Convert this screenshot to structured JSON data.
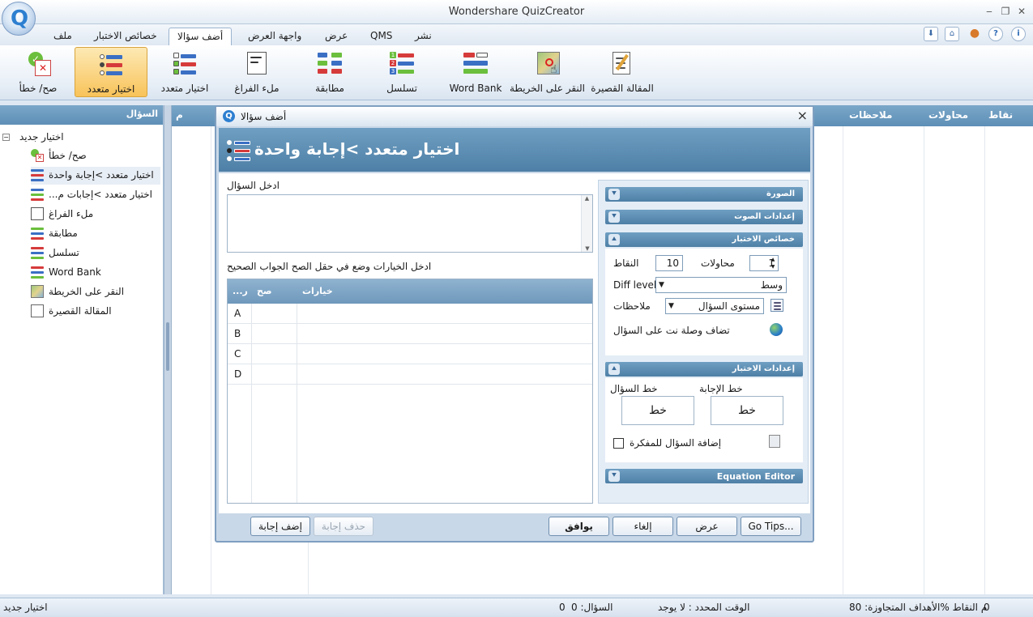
{
  "app": {
    "title": "Wondershare QuizCreator"
  },
  "tabs": {
    "file": "ملف",
    "properties": "خصائص الاختبار",
    "add_question": "أضف سؤالا",
    "ui": "واجهة العرض",
    "view": "عرض",
    "qms": "QMS",
    "publish": "نشر"
  },
  "ribbon": {
    "true_false": "صح/ خطأ",
    "mc_single": "اختيار متعدد",
    "mc_multi": "اختيار متعدد",
    "fill_blank": "ملء الفراغ",
    "matching": "مطابقة",
    "sequence": "تسلسل",
    "word_bank": "Word Bank",
    "click_map": "النقر على الخريطة",
    "short_essay": "المقالة القصيرة"
  },
  "grid_header": {
    "q": "م",
    "notes": "ملاحظات",
    "attempts": "محاولات",
    "points": "نقاط"
  },
  "left_panel": {
    "header": "السؤال",
    "root": "اختيار جديد",
    "items": [
      "صح/ خطأ",
      "اختيار متعدد >إجابة واحدة",
      "اختيار متعدد >إجابات م...",
      "ملء الفراغ",
      "مطابقة",
      "تسلسل",
      "Word Bank",
      "النقر على الخريطة",
      "المقالة القصيرة"
    ]
  },
  "dialog": {
    "title": "أضف سؤالا",
    "close": "×",
    "banner": "اختيار متعدد >إجابة واحدة",
    "question_label": "ادخل السؤال",
    "choices_instruction": "ادخل الخيارات وضع في حقل الصح الجواب الصحيح",
    "choices_header": {
      "col1": "...ر",
      "col2": "صح",
      "col3": "خيارات"
    },
    "choices": [
      "A",
      "B",
      "C",
      "D"
    ],
    "sections": {
      "image": "الصورة",
      "sound": "إعدادات الصوت",
      "props": "خصائص الاختبار",
      "settings": "إعدادات الاختبار",
      "equation": "Equation Editor"
    },
    "props": {
      "attempts_label": "محاولات",
      "attempts_value": "1",
      "points_label": "النقاط",
      "points_value": "10",
      "diff_label": "Diff level:",
      "diff_value": "وسط",
      "notes_label": "ملاحظات",
      "notes_value": "مستوى السؤال",
      "hyperlink": "تضاف وصلة نت على السؤال"
    },
    "settings": {
      "question_font": "خط السؤال",
      "answer_font": "خط الإجابة",
      "font_btn": "خط",
      "font_btn2": "خط",
      "bookmark": "إضافة السؤال للمفكرة"
    },
    "buttons": {
      "add_answer": "إضف إجابة",
      "delete_answer": "حذف إجابة",
      "ok": "يوافق",
      "cancel": "إلغاء",
      "view": "عرض",
      "tips": "Go Tips..."
    }
  },
  "status": {
    "left": "اختيار جديد",
    "questions": "السؤال: 0",
    "questions2": "0",
    "time": "الوقت المحدد : لا يوجد",
    "target": "م النقاط %الأهداف المتجاوزة: 80",
    "points0": "0"
  }
}
